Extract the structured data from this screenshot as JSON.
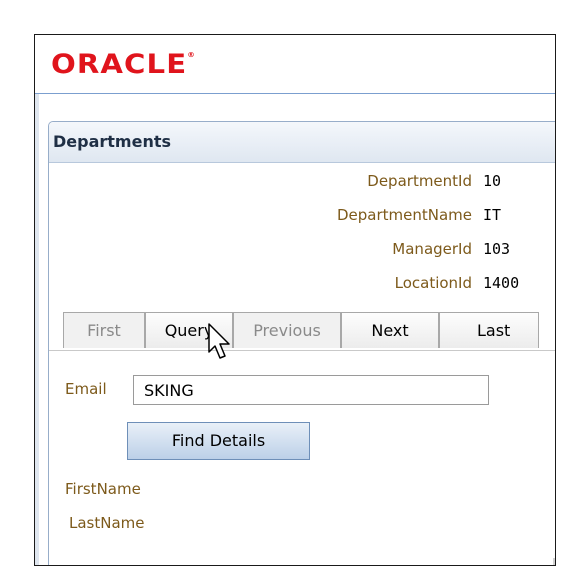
{
  "brand": {
    "logo_text": "ORACLE",
    "logo_mark": "®",
    "logo_color": "#e0141c"
  },
  "panel": {
    "title": "Departments"
  },
  "fields": [
    {
      "label": "DepartmentId",
      "value": "10"
    },
    {
      "label": "DepartmentName",
      "value": "IT"
    },
    {
      "label": "ManagerId",
      "value": "103"
    },
    {
      "label": "LocationId",
      "value": "1400"
    }
  ],
  "nav": {
    "first": "First",
    "query": "Query",
    "previous": "Previous",
    "next": "Next",
    "last": "Last"
  },
  "search": {
    "email_label": "Email",
    "email_value": "SKING",
    "find_label": "Find Details"
  },
  "results": {
    "first_name_label": "FirstName",
    "last_name_label": "LastName"
  },
  "colors": {
    "label": "#7d5a1b",
    "panel_border": "#97adc9",
    "header_bg": "#dfe7f1"
  }
}
